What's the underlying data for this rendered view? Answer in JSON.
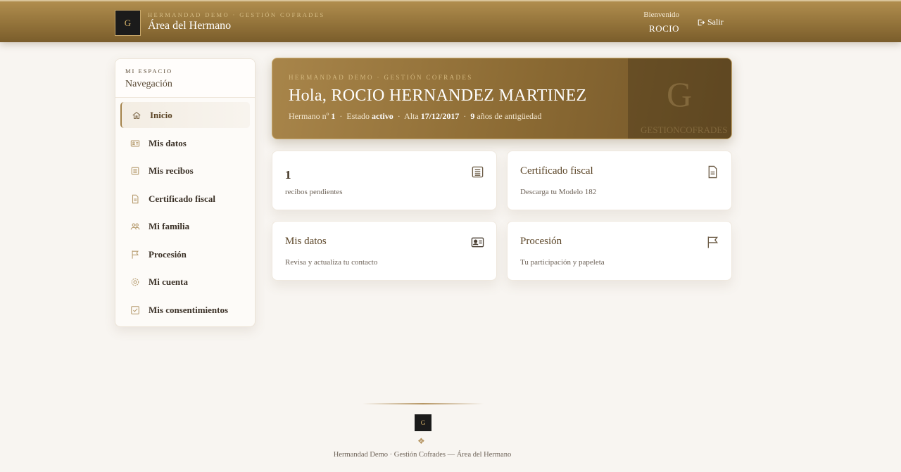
{
  "header": {
    "logo_text": "G",
    "brand_small": "HERMANDAD DEMO · GESTIÓN COFRADES",
    "title": "Área del Hermano",
    "welcome_label": "Bienvenido",
    "user_name": "ROCIO",
    "logout_label": "Salir"
  },
  "sidebar": {
    "kicker": "MI ESPACIO",
    "title": "Navegación",
    "items": [
      {
        "label": "Inicio",
        "icon": "home-icon"
      },
      {
        "label": "Mis datos",
        "icon": "id-card-icon"
      },
      {
        "label": "Mis recibos",
        "icon": "receipt-icon"
      },
      {
        "label": "Certificado fiscal",
        "icon": "document-icon"
      },
      {
        "label": "Mi familia",
        "icon": "family-icon"
      },
      {
        "label": "Procesión",
        "icon": "flag-icon"
      },
      {
        "label": "Mi cuenta",
        "icon": "gear-icon"
      },
      {
        "label": "Mis consentimientos",
        "icon": "checkbox-icon"
      }
    ]
  },
  "hero": {
    "kicker": "HERMANDAD DEMO · GESTIÓN COFRADES",
    "greeting": "Hola, ROCIO HERNANDEZ MARTINEZ",
    "meta_member_label": "Hermano nº",
    "meta_member_value": "1",
    "meta_status_label": "Estado",
    "meta_status_value": "activo",
    "meta_join_label": "Alta",
    "meta_join_value": "17/12/2017",
    "meta_seniority_value": "9",
    "meta_seniority_label": "años de antigüedad",
    "watermark_text": "GESTIONCOFRADES",
    "watermark_mono": "G"
  },
  "cards": [
    {
      "title": "1",
      "subtitle": "recibos pendientes",
      "icon": "receipt-icon"
    },
    {
      "title": "Certificado fiscal",
      "subtitle": "Descarga tu Modelo 182",
      "icon": "document-icon"
    },
    {
      "title": "Mis datos",
      "subtitle": "Revisa y actualiza tu contacto",
      "icon": "id-card-icon"
    },
    {
      "title": "Procesión",
      "subtitle": "Tu participación y papeleta",
      "icon": "flag-icon"
    }
  ],
  "footer": {
    "logo_text": "G",
    "text": "Hermandad Demo · Gestión Cofrades — Área del Hermano"
  },
  "colors": {
    "gold": "#a3824a",
    "header_gold": "#93733a",
    "background": "#f8f5f1"
  }
}
